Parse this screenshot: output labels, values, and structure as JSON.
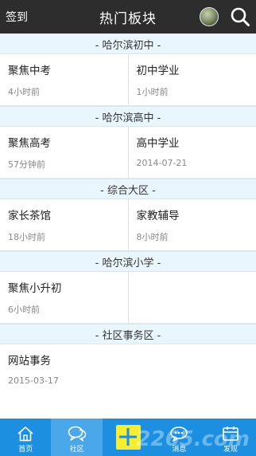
{
  "header": {
    "signin_label": "签到",
    "title": "热门板块",
    "avatar_icon": "avatar-icon",
    "search_icon": "search-icon"
  },
  "sections": [
    {
      "title": "- 哈尔滨初中 -",
      "rows": [
        [
          {
            "name": "聚焦中考",
            "time": "4小时前"
          },
          {
            "name": "初中学业",
            "time": "1小时前"
          }
        ]
      ]
    },
    {
      "title": "- 哈尔滨高中 -",
      "rows": [
        [
          {
            "name": "聚焦高考",
            "time": "57分钟前"
          },
          {
            "name": "高中学业",
            "time": "2014-07-21"
          }
        ]
      ]
    },
    {
      "title": "- 综合大区 -",
      "rows": [
        [
          {
            "name": "家长茶馆",
            "time": "18小时前"
          },
          {
            "name": "家教辅导",
            "time": "8小时前"
          }
        ]
      ]
    },
    {
      "title": "- 哈尔滨小学 -",
      "rows": [
        [
          {
            "name": "聚焦小升初",
            "time": "6小时前"
          },
          null
        ]
      ]
    },
    {
      "title": "- 社区事务区 -",
      "rows": [
        [
          {
            "name": "网站事务",
            "time": "2015-03-17"
          },
          null
        ]
      ]
    }
  ],
  "tabbar": {
    "tabs": [
      {
        "label": "首页",
        "icon": "home-icon"
      },
      {
        "label": "社区",
        "icon": "community-icon"
      },
      {
        "label": "",
        "icon": "plus-icon"
      },
      {
        "label": "消息",
        "icon": "message-icon"
      },
      {
        "label": "发现",
        "icon": "discover-icon"
      }
    ],
    "active_index": 1,
    "accent_color": "#1d8fe0",
    "add_color": "#f7ee2f"
  },
  "watermark": "2265.com"
}
